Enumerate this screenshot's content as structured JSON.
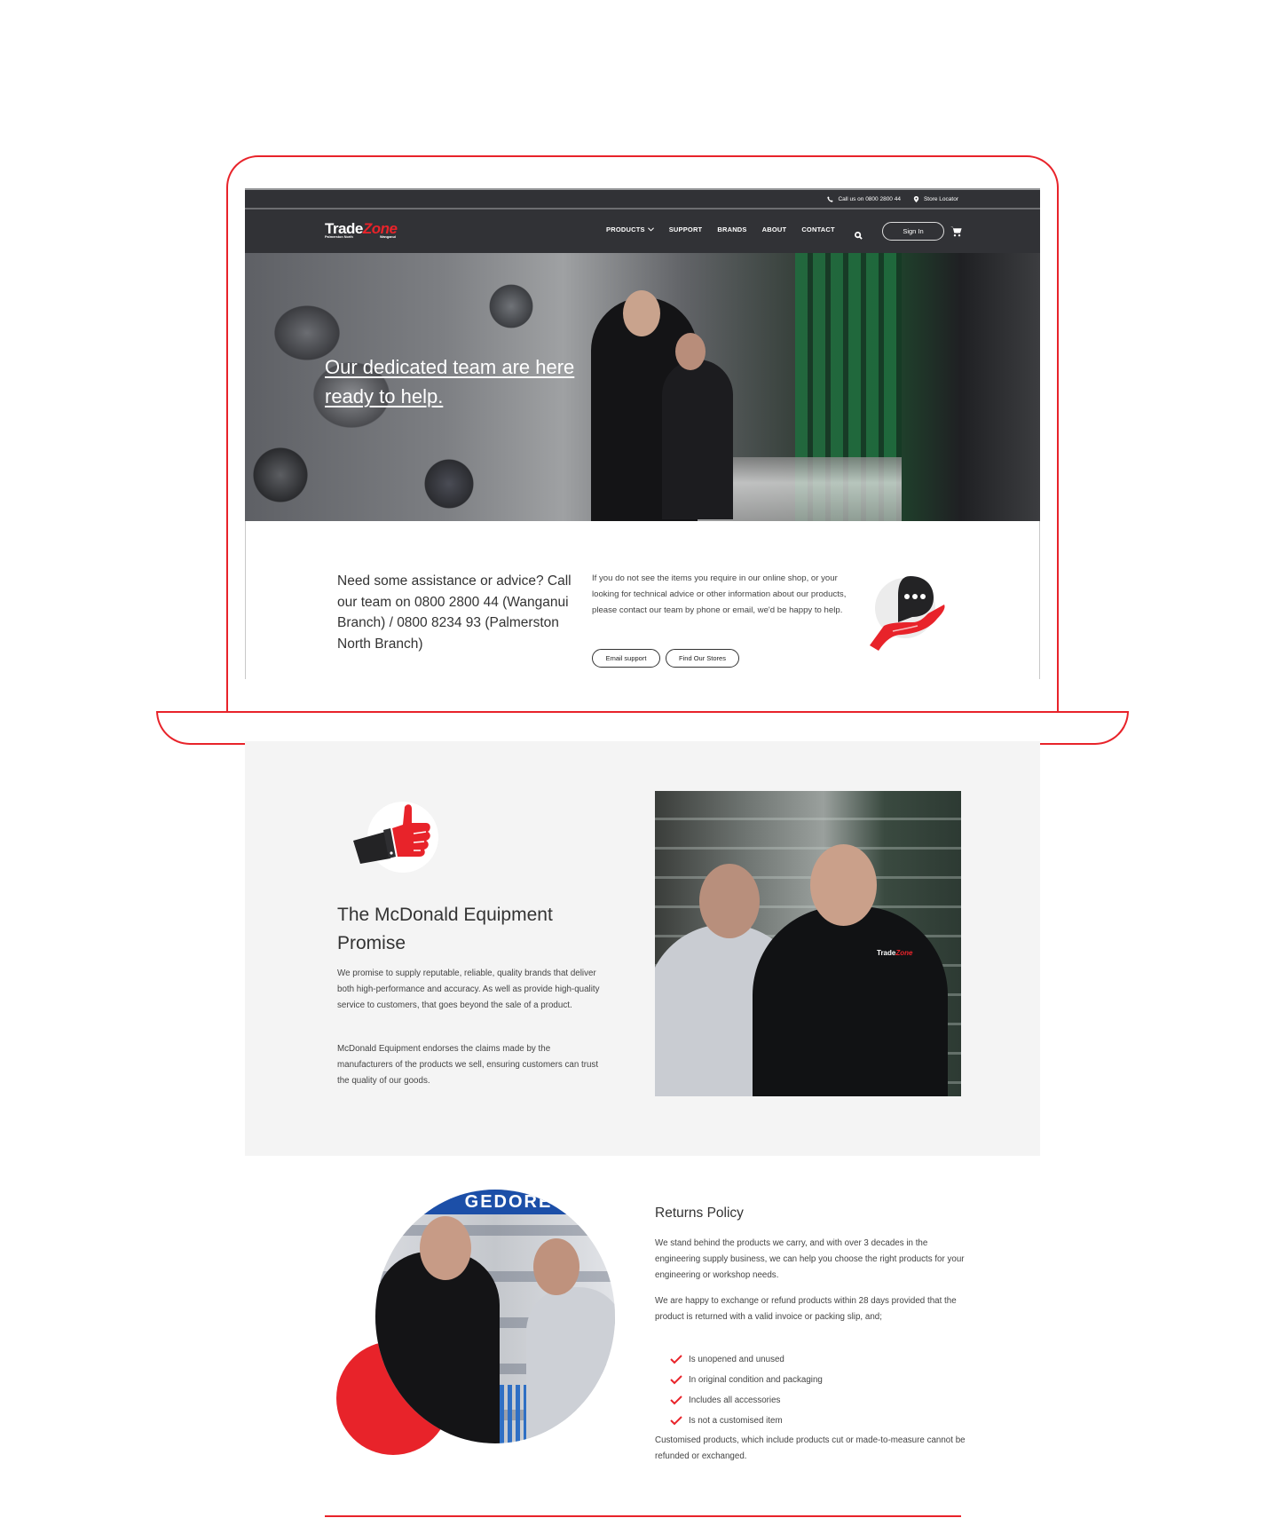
{
  "colors": {
    "brand_red": "#e8232a",
    "nav_dark": "#313236",
    "section_gray": "#f4f4f4"
  },
  "utility_bar": {
    "phone_icon": "phone-icon",
    "phone_label": "Call us on 0800 2800 44",
    "locator_icon": "map-pin-icon",
    "locator_label": "Store Locator"
  },
  "nav": {
    "logo": {
      "word1": "Trade",
      "word2": "Zone",
      "sub_left": "Palmerston North",
      "sub_right": "Wanganui"
    },
    "links": [
      {
        "label": "PRODUCTS",
        "has_dropdown": true
      },
      {
        "label": "SUPPORT"
      },
      {
        "label": "BRANDS"
      },
      {
        "label": "ABOUT"
      },
      {
        "label": "CONTACT"
      }
    ],
    "search_icon": "search-icon",
    "sign_in_label": "Sign In",
    "cart_icon": "cart-icon"
  },
  "hero": {
    "headline": "Our dedicated team are here ready to help."
  },
  "contact": {
    "heading": "Need some assistance or advice? Call our team on 0800 2800 44 (Wanganui Branch) / 0800 8234 93 (Palmerston North Branch)",
    "body": "If you do not see the items you require in our online shop, or your looking for technical advice or other information about our products, please contact our team by phone or email, we'd be happy to help.",
    "buttons": {
      "email": "Email support",
      "stores": "Find Our Stores"
    },
    "icon": "chat-hand-icon"
  },
  "promise": {
    "icon": "thumbs-up-icon",
    "title": "The McDonald Equipment Promise",
    "paragraphs": [
      "We promise to supply reputable, reliable, quality brands that deliver both high-performance and accuracy. As well as provide high-quality service to customers, that goes beyond the sale of a product.",
      "McDonald Equipment endorses the claims made by the manufacturers of the products we sell, ensuring customers can trust the quality of our goods."
    ],
    "photo_logo": {
      "word1": "Trade",
      "word2": "Zone"
    }
  },
  "returns": {
    "photo_banner": "GEDORE",
    "title": "Returns Policy",
    "paragraphs": [
      "We stand behind the products we carry, and with over 3 decades in the engineering supply business, we can help you choose the right products for your engineering or workshop needs.",
      "We are happy to exchange or refund products within 28 days provided that the product is returned with a valid invoice or packing slip, and;"
    ],
    "conditions": [
      "Is unopened and unused",
      "In original condition and packaging",
      "Includes all accessories",
      "Is not a customised item"
    ],
    "footnote": "Customised products, which include products cut or made-to-measure cannot be refunded or exchanged."
  }
}
